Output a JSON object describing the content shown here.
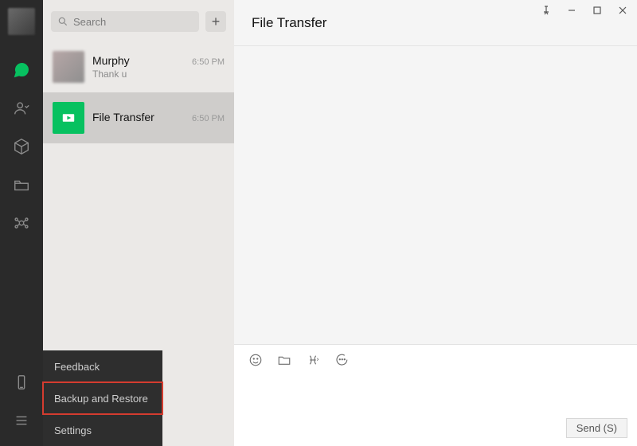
{
  "search": {
    "placeholder": "Search"
  },
  "chats": [
    {
      "name": "Murphy",
      "time": "6:50 PM",
      "preview": "Thank u"
    },
    {
      "name": "File Transfer",
      "time": "6:50 PM",
      "preview": ""
    }
  ],
  "popup": {
    "items": [
      "Feedback",
      "Backup and Restore",
      "Settings"
    ],
    "highlight_index": 1
  },
  "header": {
    "title": "File Transfer"
  },
  "composer": {
    "send_label": "Send (S)"
  }
}
